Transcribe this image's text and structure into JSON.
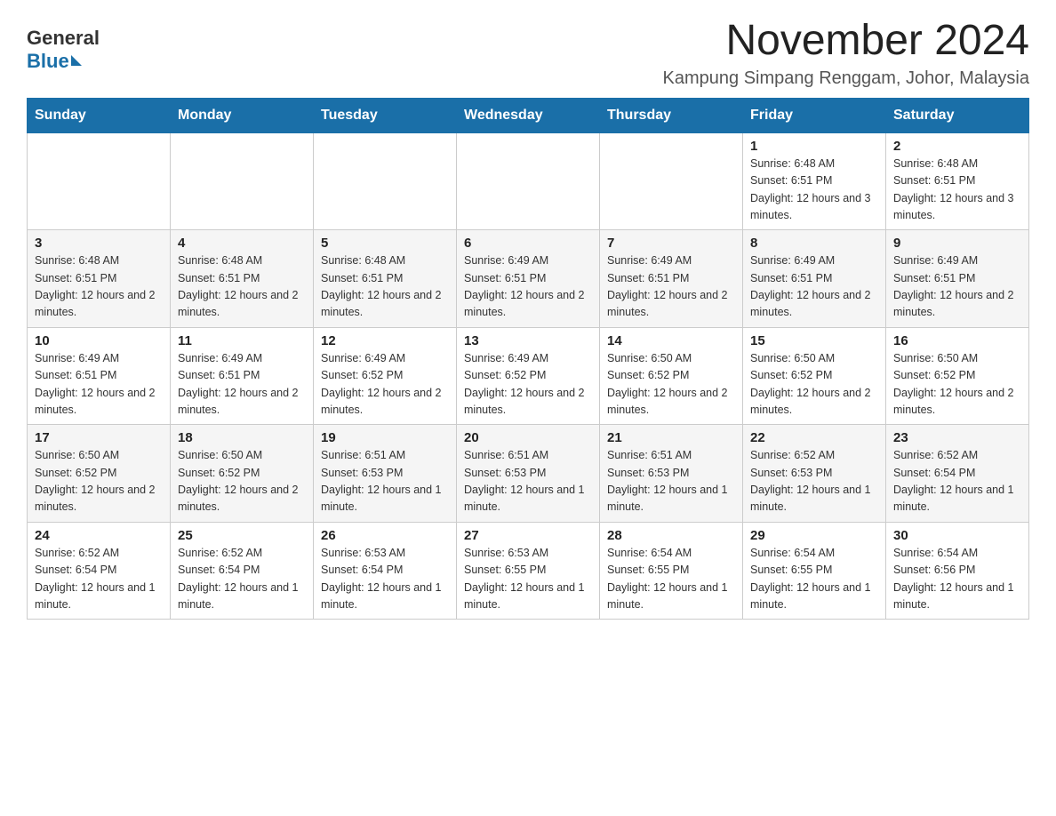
{
  "logo": {
    "general_text": "General",
    "blue_text": "Blue"
  },
  "title": "November 2024",
  "subtitle": "Kampung Simpang Renggam, Johor, Malaysia",
  "days_of_week": [
    "Sunday",
    "Monday",
    "Tuesday",
    "Wednesday",
    "Thursday",
    "Friday",
    "Saturday"
  ],
  "weeks": [
    [
      {
        "day": "",
        "info": ""
      },
      {
        "day": "",
        "info": ""
      },
      {
        "day": "",
        "info": ""
      },
      {
        "day": "",
        "info": ""
      },
      {
        "day": "",
        "info": ""
      },
      {
        "day": "1",
        "info": "Sunrise: 6:48 AM\nSunset: 6:51 PM\nDaylight: 12 hours and 3 minutes."
      },
      {
        "day": "2",
        "info": "Sunrise: 6:48 AM\nSunset: 6:51 PM\nDaylight: 12 hours and 3 minutes."
      }
    ],
    [
      {
        "day": "3",
        "info": "Sunrise: 6:48 AM\nSunset: 6:51 PM\nDaylight: 12 hours and 2 minutes."
      },
      {
        "day": "4",
        "info": "Sunrise: 6:48 AM\nSunset: 6:51 PM\nDaylight: 12 hours and 2 minutes."
      },
      {
        "day": "5",
        "info": "Sunrise: 6:48 AM\nSunset: 6:51 PM\nDaylight: 12 hours and 2 minutes."
      },
      {
        "day": "6",
        "info": "Sunrise: 6:49 AM\nSunset: 6:51 PM\nDaylight: 12 hours and 2 minutes."
      },
      {
        "day": "7",
        "info": "Sunrise: 6:49 AM\nSunset: 6:51 PM\nDaylight: 12 hours and 2 minutes."
      },
      {
        "day": "8",
        "info": "Sunrise: 6:49 AM\nSunset: 6:51 PM\nDaylight: 12 hours and 2 minutes."
      },
      {
        "day": "9",
        "info": "Sunrise: 6:49 AM\nSunset: 6:51 PM\nDaylight: 12 hours and 2 minutes."
      }
    ],
    [
      {
        "day": "10",
        "info": "Sunrise: 6:49 AM\nSunset: 6:51 PM\nDaylight: 12 hours and 2 minutes."
      },
      {
        "day": "11",
        "info": "Sunrise: 6:49 AM\nSunset: 6:51 PM\nDaylight: 12 hours and 2 minutes."
      },
      {
        "day": "12",
        "info": "Sunrise: 6:49 AM\nSunset: 6:52 PM\nDaylight: 12 hours and 2 minutes."
      },
      {
        "day": "13",
        "info": "Sunrise: 6:49 AM\nSunset: 6:52 PM\nDaylight: 12 hours and 2 minutes."
      },
      {
        "day": "14",
        "info": "Sunrise: 6:50 AM\nSunset: 6:52 PM\nDaylight: 12 hours and 2 minutes."
      },
      {
        "day": "15",
        "info": "Sunrise: 6:50 AM\nSunset: 6:52 PM\nDaylight: 12 hours and 2 minutes."
      },
      {
        "day": "16",
        "info": "Sunrise: 6:50 AM\nSunset: 6:52 PM\nDaylight: 12 hours and 2 minutes."
      }
    ],
    [
      {
        "day": "17",
        "info": "Sunrise: 6:50 AM\nSunset: 6:52 PM\nDaylight: 12 hours and 2 minutes."
      },
      {
        "day": "18",
        "info": "Sunrise: 6:50 AM\nSunset: 6:52 PM\nDaylight: 12 hours and 2 minutes."
      },
      {
        "day": "19",
        "info": "Sunrise: 6:51 AM\nSunset: 6:53 PM\nDaylight: 12 hours and 1 minute."
      },
      {
        "day": "20",
        "info": "Sunrise: 6:51 AM\nSunset: 6:53 PM\nDaylight: 12 hours and 1 minute."
      },
      {
        "day": "21",
        "info": "Sunrise: 6:51 AM\nSunset: 6:53 PM\nDaylight: 12 hours and 1 minute."
      },
      {
        "day": "22",
        "info": "Sunrise: 6:52 AM\nSunset: 6:53 PM\nDaylight: 12 hours and 1 minute."
      },
      {
        "day": "23",
        "info": "Sunrise: 6:52 AM\nSunset: 6:54 PM\nDaylight: 12 hours and 1 minute."
      }
    ],
    [
      {
        "day": "24",
        "info": "Sunrise: 6:52 AM\nSunset: 6:54 PM\nDaylight: 12 hours and 1 minute."
      },
      {
        "day": "25",
        "info": "Sunrise: 6:52 AM\nSunset: 6:54 PM\nDaylight: 12 hours and 1 minute."
      },
      {
        "day": "26",
        "info": "Sunrise: 6:53 AM\nSunset: 6:54 PM\nDaylight: 12 hours and 1 minute."
      },
      {
        "day": "27",
        "info": "Sunrise: 6:53 AM\nSunset: 6:55 PM\nDaylight: 12 hours and 1 minute."
      },
      {
        "day": "28",
        "info": "Sunrise: 6:54 AM\nSunset: 6:55 PM\nDaylight: 12 hours and 1 minute."
      },
      {
        "day": "29",
        "info": "Sunrise: 6:54 AM\nSunset: 6:55 PM\nDaylight: 12 hours and 1 minute."
      },
      {
        "day": "30",
        "info": "Sunrise: 6:54 AM\nSunset: 6:56 PM\nDaylight: 12 hours and 1 minute."
      }
    ]
  ]
}
